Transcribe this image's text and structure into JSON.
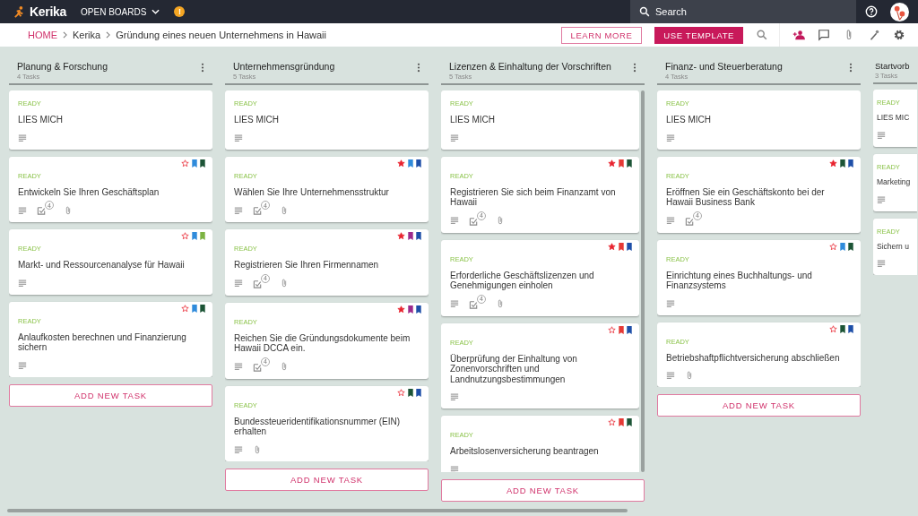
{
  "topbar": {
    "brand": "Kerika",
    "open_boards": "OPEN BOARDS",
    "alert_badge": "!",
    "search": {
      "placeholder": "Search"
    }
  },
  "breadcrumb": {
    "items": [
      "HOME",
      "Kerika",
      "Gründung eines neuen Unternehmens in Hawaii"
    ]
  },
  "actions": {
    "learn_more": "LEARN MORE",
    "use_template": "USE TEMPLATE"
  },
  "columns": [
    {
      "title": "Planung & Forschung",
      "count": "4 Tasks",
      "add_task": "ADD NEW TASK",
      "cards": [
        {
          "status": "READY",
          "title": "LIES MICH",
          "description": true
        },
        {
          "status": "READY",
          "title": "Entwickeln Sie Ihren Geschäftsplan",
          "description": true,
          "starred": false,
          "tags": [
            {
              "color": "#2f8bdb"
            },
            {
              "color": "#1c5436"
            }
          ],
          "checklist": "4",
          "attachment": true
        },
        {
          "status": "READY",
          "title": "Markt- und Ressourcenanalyse für Hawaii",
          "description": true,
          "starred": false,
          "tags": [
            {
              "color": "#2f8bdb"
            },
            {
              "color": "#7cb342"
            }
          ]
        },
        {
          "status": "READY",
          "title": "Anlaufkosten berechnen und Finanzierung sichern",
          "description": true,
          "starred": false,
          "tags": [
            {
              "color": "#2f8bdb"
            },
            {
              "color": "#1c5436"
            }
          ]
        }
      ]
    },
    {
      "title": "Unternehmensgründung",
      "count": "5 Tasks",
      "add_task": "ADD NEW TASK",
      "cards": [
        {
          "status": "READY",
          "title": "LIES MICH",
          "description": true
        },
        {
          "status": "READY",
          "title": "Wählen Sie Ihre Unternehmensstruktur",
          "description": true,
          "starred": true,
          "tags": [
            {
              "color": "#2f8bdb"
            },
            {
              "color": "#1e4fa8"
            }
          ],
          "checklist": "4",
          "attachment": true
        },
        {
          "status": "READY",
          "title": "Registrieren Sie Ihren Firmennamen",
          "description": true,
          "starred": true,
          "tags": [
            {
              "color": "#9c2a8c"
            },
            {
              "color": "#1e4fa8"
            }
          ],
          "checklist": "4",
          "attachment": true
        },
        {
          "status": "READY",
          "title": "Reichen Sie die Gründungsdokumente beim Hawaii DCCA ein.",
          "description": true,
          "starred": true,
          "tags": [
            {
              "color": "#9c2a8c"
            },
            {
              "color": "#1e4fa8"
            }
          ],
          "checklist": "4",
          "attachment": true
        },
        {
          "status": "READY",
          "title": "Bundessteueridentifikationsnummer (EIN) erhalten",
          "description": true,
          "starred": false,
          "tags": [
            {
              "color": "#1c5436"
            },
            {
              "color": "#1e4fa8"
            }
          ],
          "attachment": true
        }
      ]
    },
    {
      "title": "Lizenzen & Einhaltung der Vorschriften",
      "count": "5 Tasks",
      "add_task": "ADD NEW TASK",
      "cards": [
        {
          "status": "READY",
          "title": "LIES MICH",
          "description": true
        },
        {
          "status": "READY",
          "title": "Registrieren Sie sich beim Finanzamt von Hawaii",
          "description": true,
          "starred": true,
          "tags": [
            {
              "color": "#e53935"
            },
            {
              "color": "#1c5436"
            }
          ],
          "checklist": "4",
          "attachment": true
        },
        {
          "status": "READY",
          "title": "Erforderliche Geschäftslizenzen und Genehmigungen einholen",
          "description": true,
          "starred": true,
          "tags": [
            {
              "color": "#e53935"
            },
            {
              "color": "#1e4fa8"
            }
          ],
          "checklist": "4",
          "attachment": true
        },
        {
          "status": "READY",
          "title": "Überprüfung der Einhaltung von Zonenvorschriften und Landnutzungsbestimmungen",
          "description": true,
          "starred": false,
          "tags": [
            {
              "color": "#e53935"
            },
            {
              "color": "#1e4fa8"
            }
          ]
        },
        {
          "status": "READY",
          "title": "Arbeitslosenversicherung beantragen",
          "description": true,
          "starred": false,
          "tags": [
            {
              "color": "#e53935"
            },
            {
              "color": "#1c5436"
            }
          ]
        }
      ]
    },
    {
      "title": "Finanz- und Steuerberatung",
      "count": "4 Tasks",
      "add_task": "ADD NEW TASK",
      "cards": [
        {
          "status": "READY",
          "title": "LIES MICH",
          "description": true
        },
        {
          "status": "READY",
          "title": "Eröffnen Sie ein Geschäftskonto bei der Hawaii Business Bank",
          "description": true,
          "starred": true,
          "tags": [
            {
              "color": "#1c5436"
            },
            {
              "color": "#1e4fa8"
            }
          ],
          "checklist": "4"
        },
        {
          "status": "READY",
          "title": "Einrichtung eines Buchhaltungs- und Finanzsystems",
          "description": true,
          "starred": false,
          "tags": [
            {
              "color": "#2f8bdb"
            },
            {
              "color": "#1c5436"
            }
          ]
        },
        {
          "status": "READY",
          "title": "Betriebshaftpflichtversicherung abschließen",
          "description": true,
          "starred": false,
          "tags": [
            {
              "color": "#1c5436"
            },
            {
              "color": "#1e4fa8"
            }
          ],
          "attachment": true
        }
      ]
    },
    {
      "title": "Startvorb",
      "count": "3 Tasks",
      "cards": [
        {
          "status": "READY",
          "title": "LIES MIC",
          "description": true
        },
        {
          "status": "READY",
          "title": "Marketing",
          "description": true
        },
        {
          "status": "READY",
          "title": "Sichern u",
          "description": true
        }
      ]
    }
  ]
}
